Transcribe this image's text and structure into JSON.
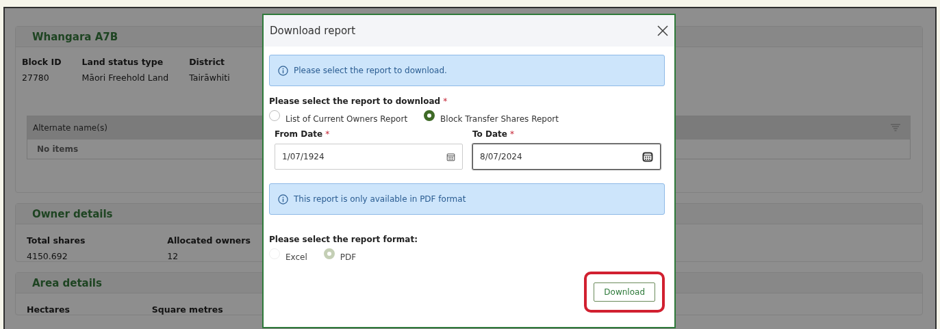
{
  "page": {
    "sections": [
      {
        "title": "Whangara A7B",
        "kind": "compact",
        "fields": [
          {
            "label": "Block ID",
            "value": "27780"
          },
          {
            "label": "Land status type",
            "value": "Māori Freehold Land"
          },
          {
            "label": "District",
            "value": "Tairāwhiti"
          }
        ],
        "grid": {
          "columns": [
            "Alternate name(s)"
          ],
          "empty_text": "No items"
        }
      },
      {
        "title": "Owner details",
        "kind": "wide",
        "fields": [
          {
            "label": "Total shares",
            "value": "4150.692"
          },
          {
            "label": "Allocated owners",
            "value": "12"
          }
        ]
      },
      {
        "title": "Area details",
        "kind": "wide",
        "fields": [
          {
            "label": "Hectares"
          },
          {
            "label": "Square metres"
          }
        ]
      }
    ]
  },
  "dialog": {
    "title": "Download report",
    "info_alert": "Please select the report to download.",
    "report_choice": {
      "label": "Please select the report to download",
      "required_mark": "*",
      "options": [
        {
          "label": "List of Current Owners Report",
          "selected": false,
          "disabled": false
        },
        {
          "label": "Block Transfer Shares Report",
          "selected": true,
          "disabled": false
        }
      ]
    },
    "dates": [
      {
        "label": "From Date",
        "required_mark": "*",
        "value": "1/07/1924",
        "focused": false
      },
      {
        "label": "To Date",
        "required_mark": "*",
        "value": "8/07/2024",
        "focused": true
      }
    ],
    "format_alert": "This report is only available in PDF format",
    "format_choice": {
      "label": "Please select the report format:",
      "options": [
        {
          "label": "Excel",
          "selected": false,
          "disabled": true
        },
        {
          "label": "PDF",
          "selected": true,
          "disabled": true
        }
      ]
    },
    "download_button": {
      "label": "Download",
      "highlighted": true
    }
  }
}
